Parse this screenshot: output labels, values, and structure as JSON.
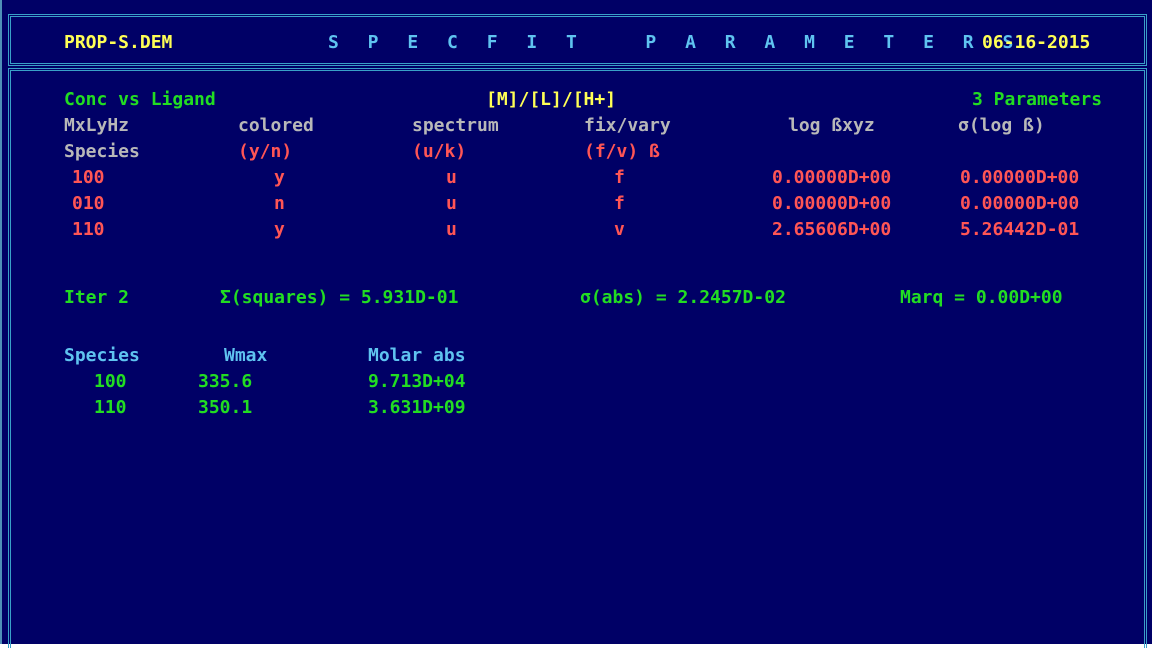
{
  "header": {
    "filename": "PROP-S.DEM",
    "title": "S P E C F I T   P A R A M E T E R S",
    "date": "06-16-2015"
  },
  "summary": {
    "mode": "Conc vs Ligand",
    "concentrations": "[M]/[L]/[H+]",
    "param_count": "3 Parameters"
  },
  "columns": {
    "h1": [
      "MxLyHz",
      "colored",
      "spectrum",
      "fix/vary",
      "log ßxyz",
      "σ(log ß)"
    ],
    "h2": [
      "Species",
      "(y/n)",
      "(u/k)",
      "(f/v) ß"
    ]
  },
  "species_rows": [
    {
      "id": "100",
      "colored": "y",
      "spectrum": "u",
      "fixvary": "f",
      "logb": "0.00000D+00",
      "sigma": "0.00000D+00"
    },
    {
      "id": "010",
      "colored": "n",
      "spectrum": "u",
      "fixvary": "f",
      "logb": "0.00000D+00",
      "sigma": "0.00000D+00"
    },
    {
      "id": "110",
      "colored": "y",
      "spectrum": "u",
      "fixvary": "v",
      "logb": "2.65606D+00",
      "sigma": "5.26442D-01"
    }
  ],
  "iteration": {
    "iter": "Iter 2",
    "squares": "Σ(squares) = 5.931D-01",
    "sigma_abs": "σ(abs) = 2.2457D-02",
    "marq": "Marq = 0.00D+00"
  },
  "absorbance": {
    "headers": [
      "Species",
      "Wmax",
      "Molar abs"
    ],
    "rows": [
      {
        "species": "100",
        "wmax": "335.6",
        "molar": "9.713D+04"
      },
      {
        "species": "110",
        "wmax": "350.1",
        "molar": "3.631D+09"
      }
    ]
  },
  "colors": {
    "background": "#000066",
    "yellow": "#ffff55",
    "cyan": "#5fc3f0",
    "green": "#22dd22",
    "red": "#ff5555",
    "gray": "#b8b8b8"
  }
}
